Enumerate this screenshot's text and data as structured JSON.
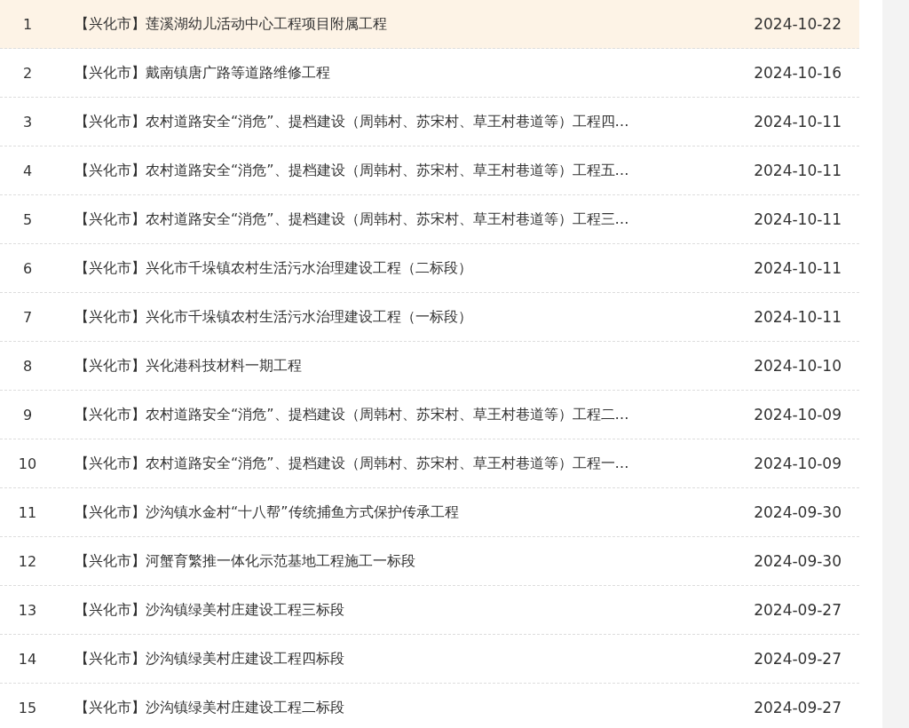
{
  "rows": [
    {
      "index": "1",
      "title": "【兴化市】莲溪湖幼儿活动中心工程项目附属工程",
      "date": "2024-10-22",
      "selected": true
    },
    {
      "index": "2",
      "title": "【兴化市】戴南镇唐广路等道路维修工程",
      "date": "2024-10-16",
      "selected": false
    },
    {
      "index": "3",
      "title": "【兴化市】农村道路安全“消危”、提档建设（周韩村、苏宋村、草王村巷道等）工程四…",
      "date": "2024-10-11",
      "selected": false
    },
    {
      "index": "4",
      "title": "【兴化市】农村道路安全“消危”、提档建设（周韩村、苏宋村、草王村巷道等）工程五…",
      "date": "2024-10-11",
      "selected": false
    },
    {
      "index": "5",
      "title": "【兴化市】农村道路安全“消危”、提档建设（周韩村、苏宋村、草王村巷道等）工程三…",
      "date": "2024-10-11",
      "selected": false
    },
    {
      "index": "6",
      "title": "【兴化市】兴化市千垛镇农村生活污水治理建设工程（二标段）",
      "date": "2024-10-11",
      "selected": false
    },
    {
      "index": "7",
      "title": "【兴化市】兴化市千垛镇农村生活污水治理建设工程（一标段）",
      "date": "2024-10-11",
      "selected": false
    },
    {
      "index": "8",
      "title": "【兴化市】兴化港科技材料一期工程",
      "date": "2024-10-10",
      "selected": false
    },
    {
      "index": "9",
      "title": "【兴化市】农村道路安全“消危”、提档建设（周韩村、苏宋村、草王村巷道等）工程二…",
      "date": "2024-10-09",
      "selected": false
    },
    {
      "index": "10",
      "title": "【兴化市】农村道路安全“消危”、提档建设（周韩村、苏宋村、草王村巷道等）工程一…",
      "date": "2024-10-09",
      "selected": false
    },
    {
      "index": "11",
      "title": "【兴化市】沙沟镇水金村“十八帮”传统捕鱼方式保护传承工程",
      "date": "2024-09-30",
      "selected": false
    },
    {
      "index": "12",
      "title": "【兴化市】河蟹育繁推一体化示范基地工程施工一标段",
      "date": "2024-09-30",
      "selected": false
    },
    {
      "index": "13",
      "title": "【兴化市】沙沟镇绿美村庄建设工程三标段",
      "date": "2024-09-27",
      "selected": false
    },
    {
      "index": "14",
      "title": "【兴化市】沙沟镇绿美村庄建设工程四标段",
      "date": "2024-09-27",
      "selected": false
    },
    {
      "index": "15",
      "title": "【兴化市】沙沟镇绿美村庄建设工程二标段",
      "date": "2024-09-27",
      "selected": false
    }
  ]
}
